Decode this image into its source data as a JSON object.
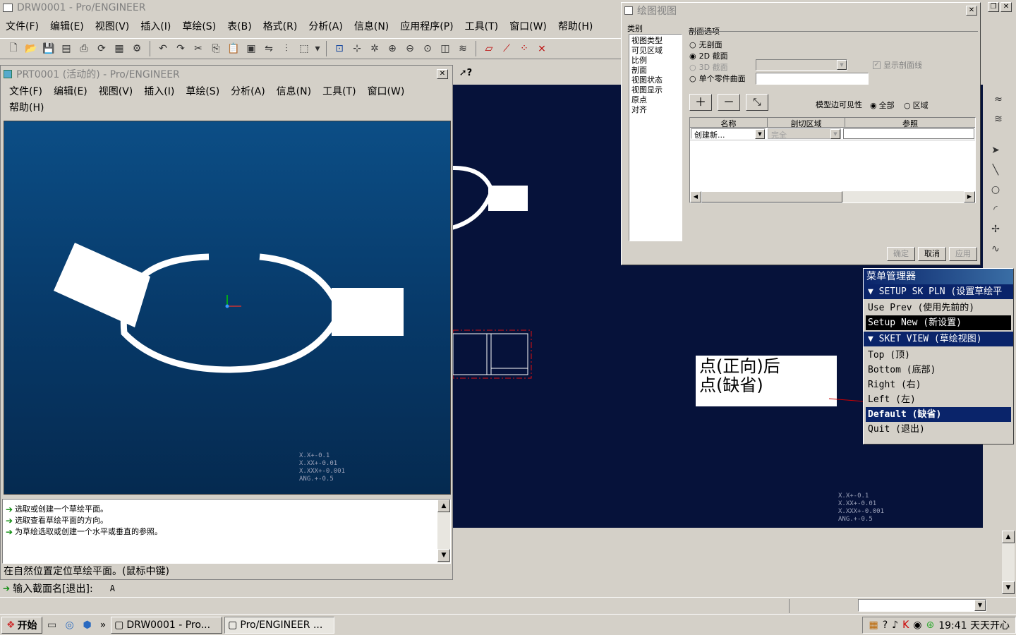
{
  "main_window": {
    "title": "DRW0001 - Pro/ENGINEER",
    "menu": [
      "文件(F)",
      "编辑(E)",
      "视图(V)",
      "插入(I)",
      "草绘(S)",
      "表(B)",
      "格式(R)",
      "分析(A)",
      "信息(N)",
      "应用程序(P)",
      "工具(T)",
      "窗口(W)",
      "帮助(H)"
    ]
  },
  "part_window": {
    "title": "PRT0001 (活动的) - Pro/ENGINEER",
    "menu": [
      "文件(F)",
      "编辑(E)",
      "视图(V)",
      "插入(I)",
      "草绘(S)",
      "分析(A)",
      "信息(N)",
      "工具(T)",
      "窗口(W)"
    ],
    "menu_row2": [
      "帮助(H)"
    ]
  },
  "tolerance": [
    "X.X+-0.1",
    "X.XX+-0.01",
    "X.XXX+-0.001",
    "ANG.+-0.5"
  ],
  "messages": [
    "选取或创建一个草绘平面。",
    "选取查看草绘平面的方向。",
    "为草绘选取或创建一个水平或垂直的参照。"
  ],
  "status_line": "在自然位置定位草绘平面。(鼠标中键)",
  "input_prompt": "输入截面名[退出]:",
  "input_value": "A",
  "dialog": {
    "title": "绘图视图",
    "category_label": "类别",
    "categories": [
      "视图类型",
      "可见区域",
      "比例",
      "剖面",
      "视图状态",
      "视图显示",
      "原点",
      "对齐"
    ],
    "section_label": "剖面选项",
    "radio_none": "无剖面",
    "radio_2d": "2D 截面",
    "radio_3d": "3D 截面",
    "radio_single": "单个零件曲面",
    "show_hatch": "显示剖面线",
    "visibility_label": "模型边可见性",
    "vis_all": "全部",
    "vis_area": "区域",
    "columns": [
      "名称",
      "剖切区域",
      "参照"
    ],
    "row_name": "创建新...",
    "row_area": "完全",
    "btn_ok": "确定",
    "btn_cancel": "取消",
    "btn_apply": "应用"
  },
  "menu_manager": {
    "title": "菜单管理器",
    "group1": "SETUP SK PLN (设置草绘平",
    "group1_items": [
      "Use Prev (使用先前的)",
      "Setup New (新设置)"
    ],
    "group2": "SKET VIEW (草绘视图)",
    "group2_items": [
      "Top (顶)",
      "Bottom (底部)",
      "Right (右)",
      "Left (左)",
      "Default (缺省)",
      "Quit (退出)"
    ]
  },
  "annotation": {
    "line1": "点(正向)后",
    "line2": "点(缺省)"
  },
  "help_label": "?",
  "taskbar": {
    "start": "开始",
    "tasks": [
      "DRW0001 - Pro...",
      "Pro/ENGINEER ..."
    ],
    "clock": "19:41 天天开心",
    "chevron": "»"
  }
}
